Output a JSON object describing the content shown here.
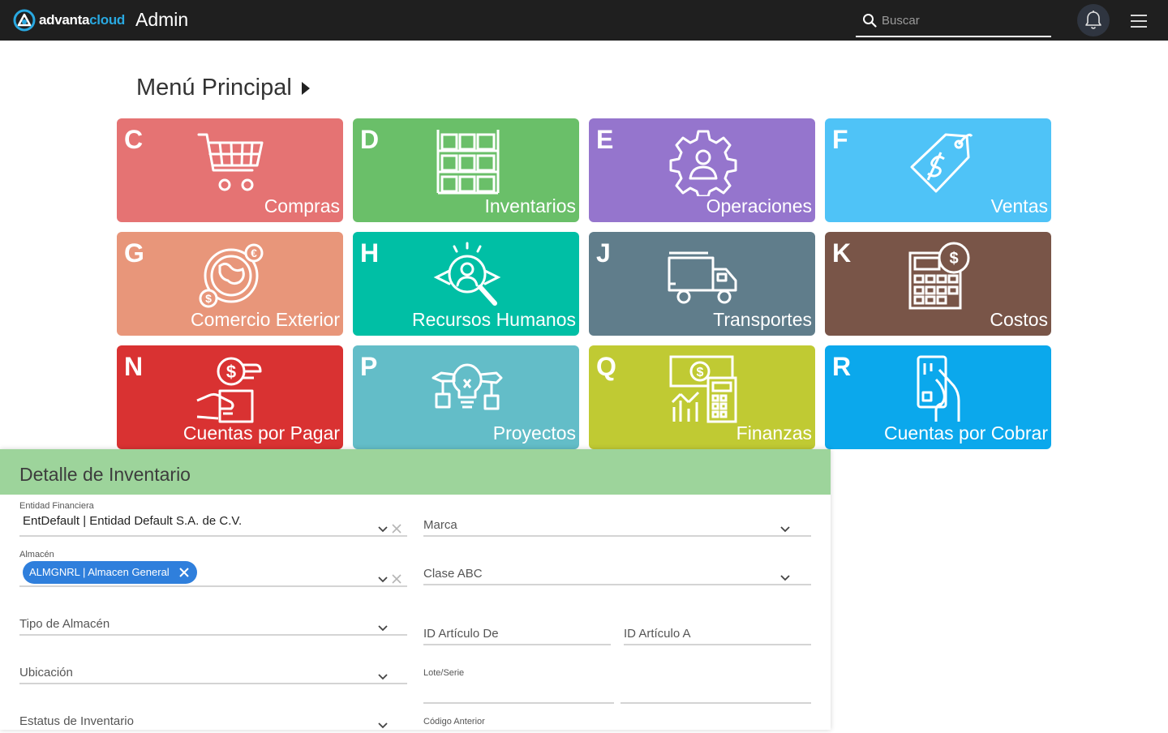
{
  "header": {
    "brand_part1": "advanta",
    "brand_part2": "cloud",
    "app_title": "Admin",
    "search_placeholder": "Buscar",
    "icons": [
      "advanta-logo-icon",
      "search-icon",
      "bell-icon",
      "hamburger-menu-icon"
    ]
  },
  "menu": {
    "title": "Menú Principal",
    "tiles": [
      {
        "letter": "C",
        "label": "Compras",
        "color": "#e57373",
        "icon": "shopping-cart-icon"
      },
      {
        "letter": "D",
        "label": "Inventarios",
        "color": "#6abf69",
        "icon": "warehouse-shelves-icon"
      },
      {
        "letter": "E",
        "label": "Operaciones",
        "color": "#9575cd",
        "icon": "gear-person-icon"
      },
      {
        "letter": "F",
        "label": "Ventas",
        "color": "#4fc3f7",
        "icon": "price-tag-icon"
      },
      {
        "letter": "G",
        "label": "Comercio Exterior",
        "color": "#e8967a",
        "icon": "globe-currency-icon"
      },
      {
        "letter": "H",
        "label": "Recursos Humanos",
        "color": "#00bfa5",
        "icon": "person-search-icon"
      },
      {
        "letter": "J",
        "label": "Transportes",
        "color": "#607d8b",
        "icon": "truck-icon"
      },
      {
        "letter": "K",
        "label": "Costos",
        "color": "#795548",
        "icon": "calculator-dollar-icon"
      },
      {
        "letter": "N",
        "label": "Cuentas por Pagar",
        "color": "#d93232",
        "icon": "hand-dollar-icon"
      },
      {
        "letter": "P",
        "label": "Proyectos",
        "color": "#63bdc8",
        "icon": "lightbulb-project-icon"
      },
      {
        "letter": "Q",
        "label": "Finanzas",
        "color": "#c0ca33",
        "icon": "finance-calculator-icon"
      },
      {
        "letter": "R",
        "label": "Cuentas por Cobrar",
        "color": "#0ba8ec",
        "icon": "hand-card-icon"
      }
    ]
  },
  "panel": {
    "title": "Detalle de Inventario",
    "header_color": "#9dd49b",
    "entidad": {
      "label": "Entidad Financiera",
      "value": "EntDefault | Entidad Default S.A. de C.V."
    },
    "almacen": {
      "label": "Almacén",
      "chip": "ALMGNRL | Almacen General",
      "chip_color": "#2f7fdc"
    },
    "tipo_almacen": {
      "placeholder": "Tipo de Almacén"
    },
    "ubicacion": {
      "placeholder": "Ubicación"
    },
    "estatus": {
      "placeholder": "Estatus de Inventario"
    },
    "marca": {
      "placeholder": "Marca"
    },
    "clase_abc": {
      "placeholder": "Clase ABC"
    },
    "articulo_de": {
      "placeholder": "ID Artículo De"
    },
    "articulo_a": {
      "placeholder": "ID Artículo A"
    },
    "lote_serie": {
      "label": "Lote/Serie"
    },
    "codigo_anterior": {
      "label": "Código Anterior"
    }
  }
}
